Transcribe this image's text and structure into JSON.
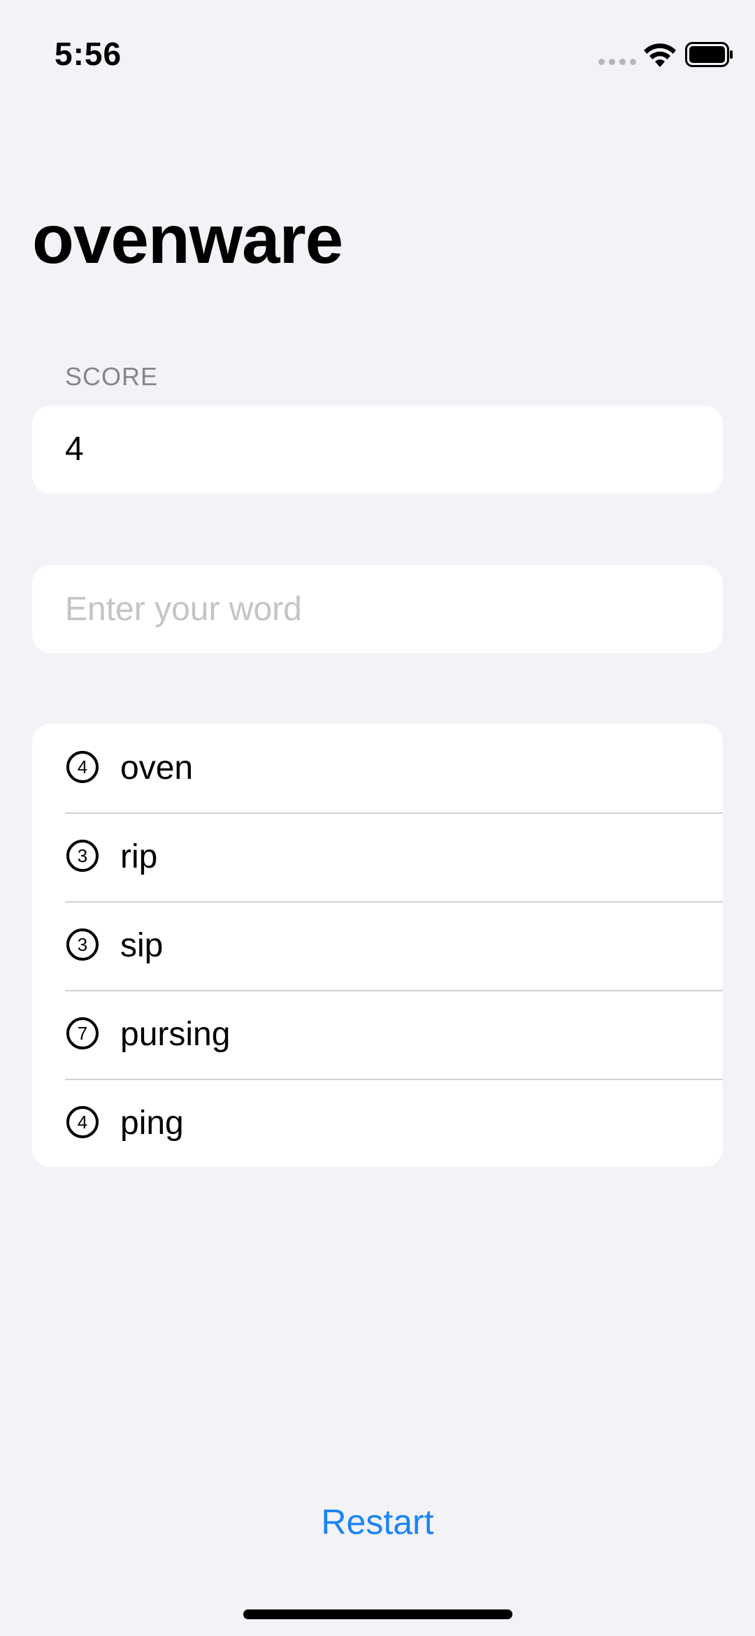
{
  "status_bar": {
    "time": "5:56",
    "icons": [
      "cellular-signal-icon",
      "wifi-icon",
      "battery-icon"
    ]
  },
  "root_word": "ovenware",
  "score": {
    "header": "SCORE",
    "value": "4"
  },
  "input": {
    "placeholder": "Enter your word",
    "value": ""
  },
  "used_words": [
    {
      "count": "4",
      "word": "oven"
    },
    {
      "count": "3",
      "word": "rip"
    },
    {
      "count": "3",
      "word": "sip"
    },
    {
      "count": "7",
      "word": "pursing"
    },
    {
      "count": "4",
      "word": "ping"
    }
  ],
  "restart_label": "Restart",
  "colors": {
    "background": "#f2f2f7",
    "card": "#ffffff",
    "accent": "#1a84f5",
    "secondary_text": "#85858a",
    "placeholder": "#c4c4c7"
  }
}
